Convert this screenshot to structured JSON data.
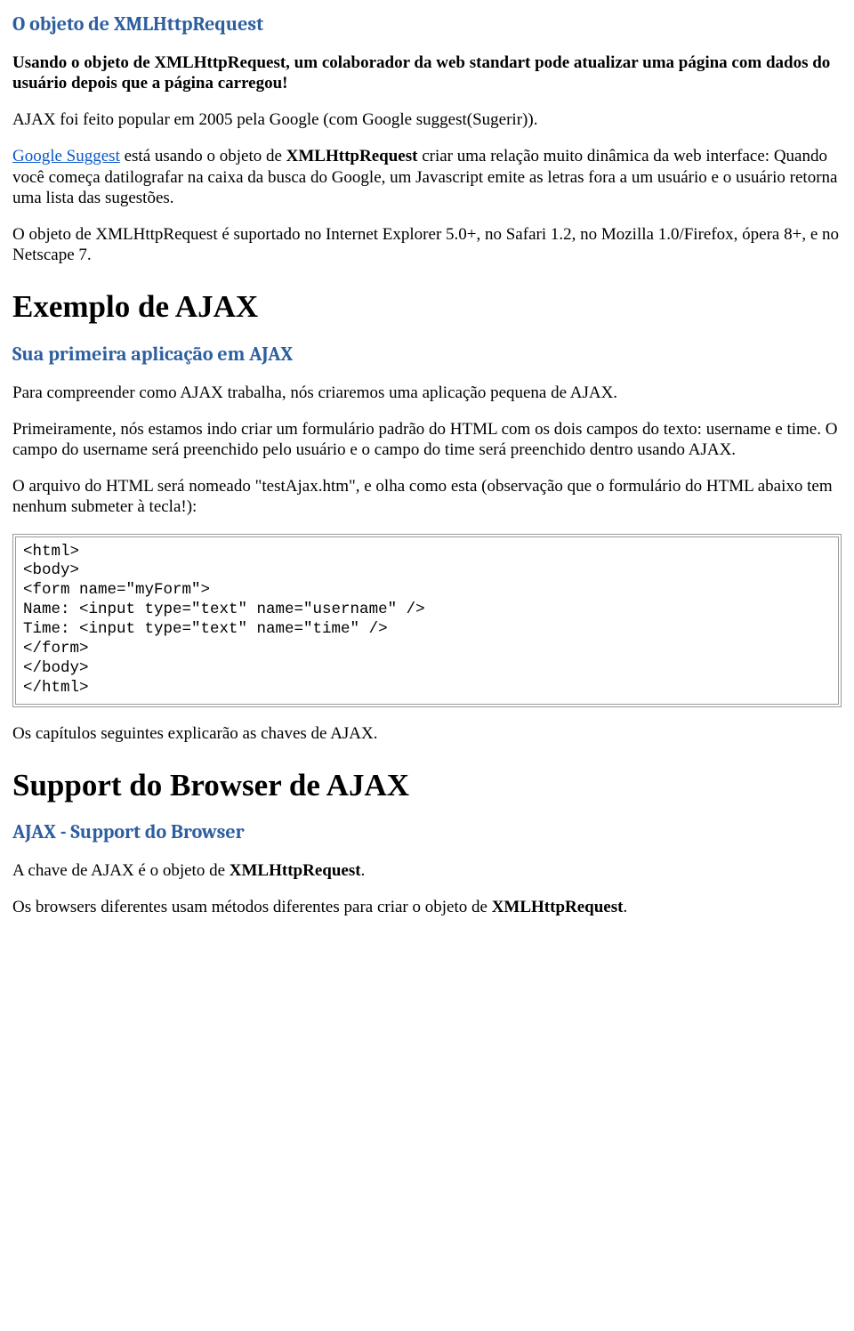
{
  "section1": {
    "heading": "O objeto de XMLHttpRequest",
    "p1": "Usando o objeto de XMLHttpRequest, um colaborador da web standart pode atualizar uma página com dados do usuário depois que a página carregou!",
    "p2": "AJAX foi feito popular em 2005 pela Google (com Google suggest(Sugerir)).",
    "p3_link": "Google Suggest",
    "p3_after_link": " está usando o objeto de ",
    "p3_bold": "XMLHttpRequest",
    "p3_rest": " criar uma relação muito dinâmica da web interface: Quando você começa datilografar na caixa da busca do Google, um Javascript emite as letras fora a um usuário e o usuário retorna uma lista das sugestões.",
    "p4": "O objeto de XMLHttpRequest é suportado no Internet Explorer 5.0+, no Safari 1.2, no Mozilla 1.0/Firefox, ópera 8+, e no Netscape 7."
  },
  "section2": {
    "h1": "Exemplo de AJAX",
    "subheading": "Sua primeira aplicação em AJAX",
    "p1": "Para compreender como AJAX trabalha, nós criaremos uma aplicação pequena de AJAX.",
    "p2": " Primeiramente, nós estamos indo criar um formulário padrão do HTML com os dois campos do texto: username e time. O campo do username será preenchido pelo usuário e o campo do time será preenchido dentro usando AJAX.",
    "p3": "O arquivo do HTML será nomeado \"testAjax.htm\", e olha como esta (observação que o formulário do HTML abaixo tem nenhum submeter à tecla!):",
    "code": "<html>\n<body>\n<form name=\"myForm\">\nName: <input type=\"text\" name=\"username\" />\nTime: <input type=\"text\" name=\"time\" />\n</form>\n</body>\n</html>",
    "p4": "Os capítulos seguintes explicarão as chaves de AJAX."
  },
  "section3": {
    "h1": "Support do Browser de AJAX",
    "subheading": "AJAX - Support do Browser",
    "p1_a": "A chave de AJAX é o objeto de ",
    "p1_b": "XMLHttpRequest",
    "p1_c": ".",
    "p2_a": " Os browsers diferentes usam métodos diferentes para criar o objeto de ",
    "p2_b": "XMLHttpRequest",
    "p2_c": "."
  }
}
